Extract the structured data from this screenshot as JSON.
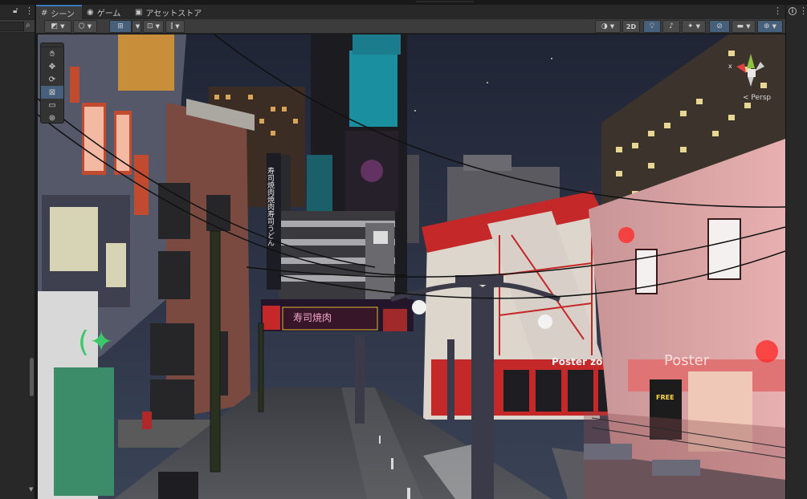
{
  "tabs": [
    {
      "label": "シーン",
      "icon": "grid-icon",
      "active": true
    },
    {
      "label": "ゲーム",
      "icon": "gamepad-icon",
      "active": false
    },
    {
      "label": "アセットストア",
      "icon": "bag-icon",
      "active": false
    }
  ],
  "toolbar": {
    "mode_2d_label": "2D"
  },
  "gizmo": {
    "projection_label": "< Persp",
    "x_label": "x"
  },
  "scene_signs": {
    "poster_zone": "Poster zone",
    "poster": "Poster",
    "free": "FREE",
    "neon_main": "寿司焼肉",
    "vertical_sign": "寿司焼肉焼肉寿司うどん"
  },
  "colors": {
    "accent": "#3a79bb",
    "tool_active": "#46607c",
    "panel": "#282828",
    "toolbar": "#3c3c3c"
  }
}
